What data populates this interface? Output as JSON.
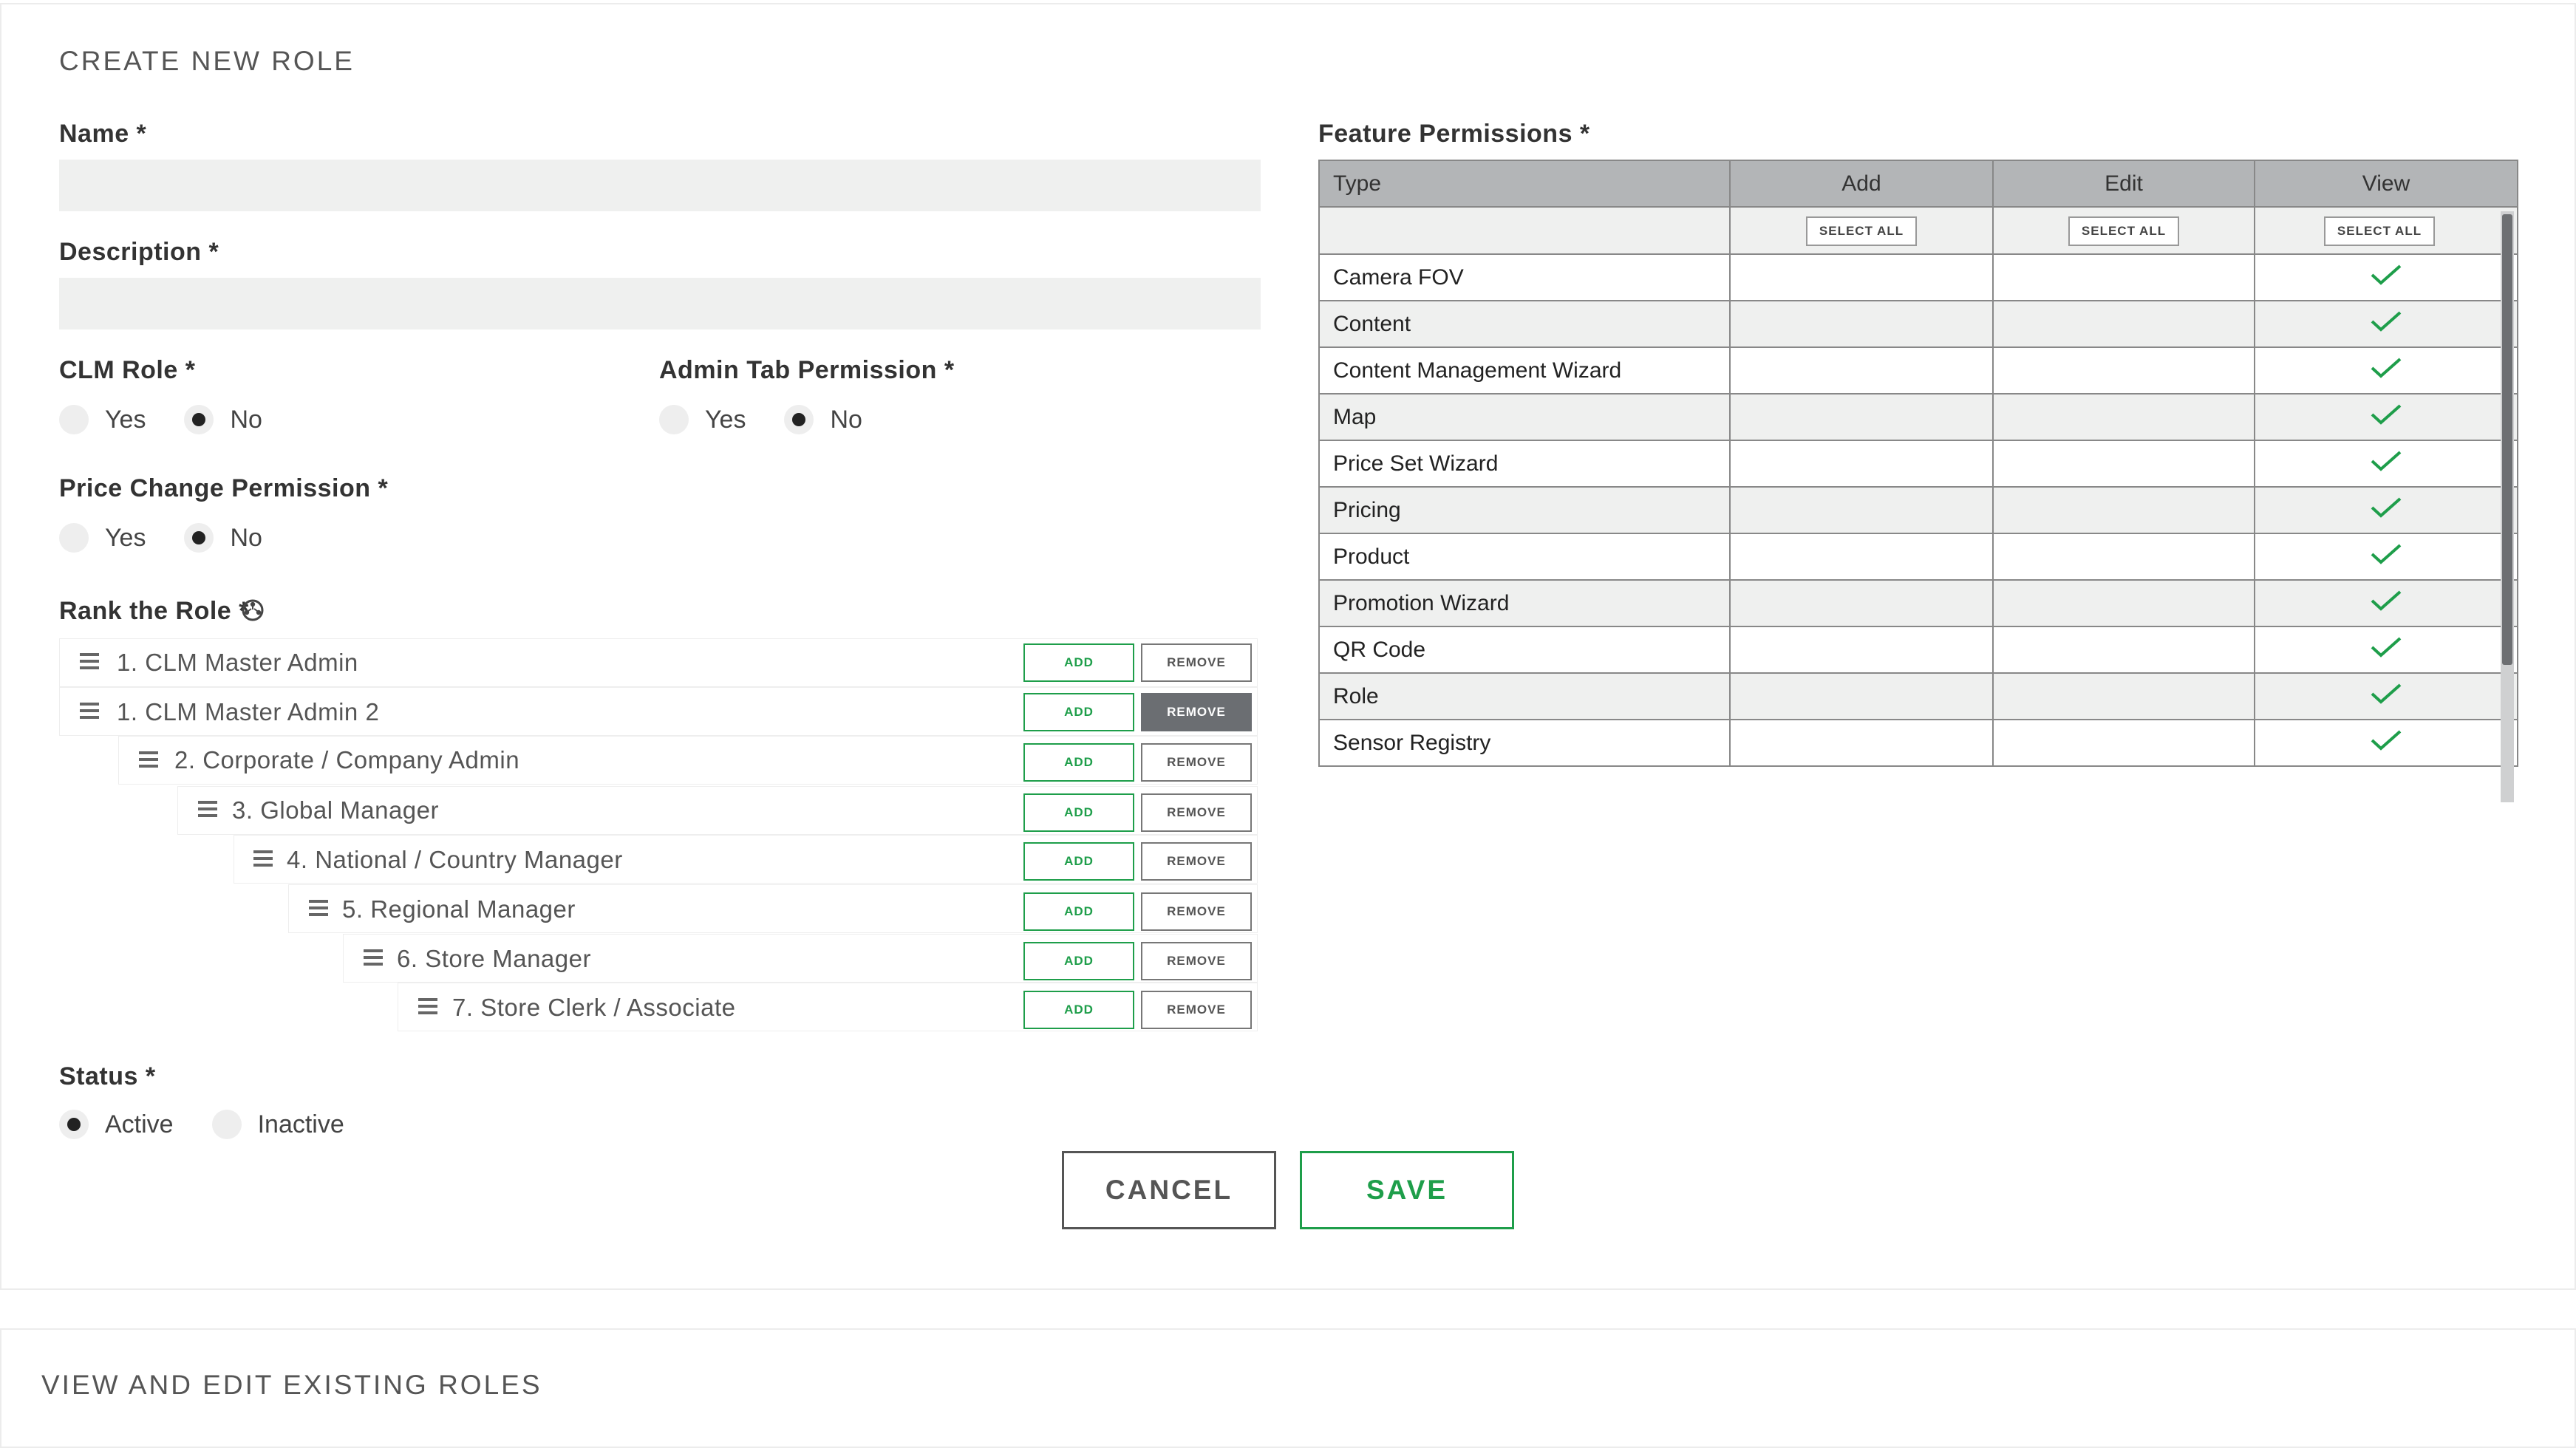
{
  "create_section": {
    "title": "CREATE NEW ROLE",
    "name_label": "Name *",
    "name_value": "",
    "description_label": "Description *",
    "description_value": "",
    "clm_role": {
      "label": "CLM Role *",
      "options": [
        "Yes",
        "No"
      ],
      "selected": "No"
    },
    "admin_tab": {
      "label": "Admin Tab Permission *",
      "options": [
        "Yes",
        "No"
      ],
      "selected": "No"
    },
    "price_change": {
      "label": "Price Change Permission *",
      "options": [
        "Yes",
        "No"
      ],
      "selected": "No"
    },
    "rank": {
      "label": "Rank the Role *",
      "add_label": "ADD",
      "remove_label": "REMOVE",
      "rows": [
        {
          "text": "1. CLM Master Admin",
          "remove_active": false
        },
        {
          "text": "1. CLM Master Admin 2",
          "remove_active": true
        },
        {
          "text": "2. Corporate / Company Admin",
          "remove_active": false
        },
        {
          "text": "3. Global Manager",
          "remove_active": false
        },
        {
          "text": "4. National / Country Manager",
          "remove_active": false
        },
        {
          "text": "5. Regional Manager",
          "remove_active": false
        },
        {
          "text": "6. Store Manager",
          "remove_active": false
        },
        {
          "text": "7. Store Clerk / Associate",
          "remove_active": false
        }
      ]
    },
    "status": {
      "label": "Status *",
      "options": [
        "Active",
        "Inactive"
      ],
      "selected": "Active"
    },
    "cancel_label": "CANCEL",
    "save_label": "SAVE"
  },
  "feature_permissions": {
    "label": "Feature Permissions *",
    "columns": [
      "Type",
      "Add",
      "Edit",
      "View"
    ],
    "select_all_label": "SELECT ALL",
    "rows": [
      {
        "type": "Camera FOV",
        "add": false,
        "edit": false,
        "view": true
      },
      {
        "type": "Content",
        "add": false,
        "edit": false,
        "view": true
      },
      {
        "type": "Content Management Wizard",
        "add": false,
        "edit": false,
        "view": true
      },
      {
        "type": "Map",
        "add": false,
        "edit": false,
        "view": true
      },
      {
        "type": "Price Set Wizard",
        "add": false,
        "edit": false,
        "view": true
      },
      {
        "type": "Pricing",
        "add": false,
        "edit": false,
        "view": true
      },
      {
        "type": "Product",
        "add": false,
        "edit": false,
        "view": true
      },
      {
        "type": "Promotion Wizard",
        "add": false,
        "edit": false,
        "view": true
      },
      {
        "type": "QR Code",
        "add": false,
        "edit": false,
        "view": true
      },
      {
        "type": "Role",
        "add": false,
        "edit": false,
        "view": true
      },
      {
        "type": "Sensor Registry",
        "add": false,
        "edit": false,
        "view": true
      }
    ]
  },
  "existing_section": {
    "title": "VIEW AND EDIT EXISTING ROLES"
  },
  "colors": {
    "accent": "#1e9e4a",
    "header_gray": "#b3b5b7",
    "input_bg": "#eff0ef"
  }
}
